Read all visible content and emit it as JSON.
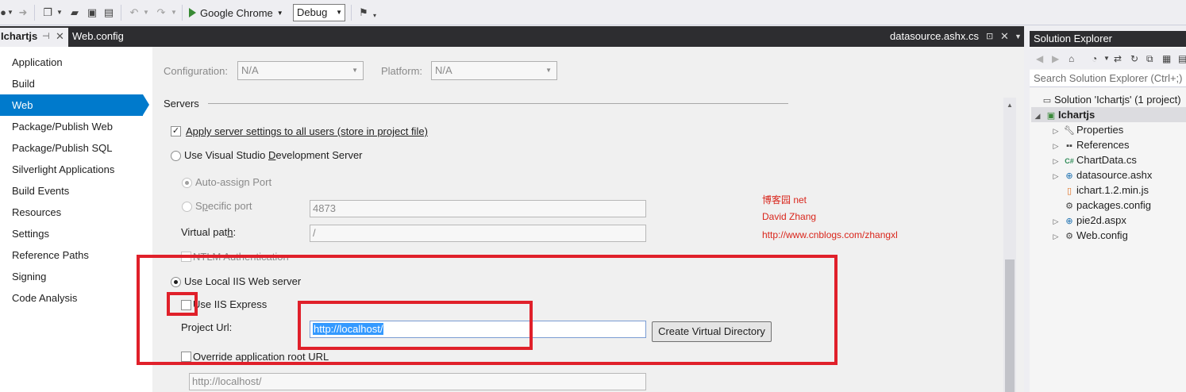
{
  "toolbar": {
    "run_target": "Google Chrome",
    "configuration": "Debug"
  },
  "tabs": {
    "active": "Ichartjs",
    "second": "Web.config",
    "right": "datasource.ashx.cs"
  },
  "nav": {
    "items": [
      "Application",
      "Build",
      "Web",
      "Package/Publish Web",
      "Package/Publish SQL",
      "Silverlight Applications",
      "Build Events",
      "Resources",
      "Settings",
      "Reference Paths",
      "Signing",
      "Code Analysis"
    ],
    "selected": "Web"
  },
  "config_bar": {
    "configuration_label": "Configuration:",
    "configuration_value": "N/A",
    "platform_label": "Platform:",
    "platform_value": "N/A"
  },
  "servers": {
    "section_title": "Servers",
    "apply_settings_label": "Apply server settings to all users (store in project file)",
    "apply_settings_checked": true,
    "vs_dev_server_label_pre": "Use Visual Studio ",
    "vs_dev_server_label_u": "D",
    "vs_dev_server_label_post": "evelopment Server",
    "auto_assign_port_label": "Auto-assign Port",
    "specific_port_label_pre": "S",
    "specific_port_label_u": "p",
    "specific_port_label_post": "ecific port",
    "specific_port_value": "4873",
    "virtual_path_label_pre": "Virtual pat",
    "virtual_path_label_u": "h",
    "virtual_path_label_post": ":",
    "virtual_path_value": "/",
    "ntlm_label": "NTLM Authentication",
    "local_iis_label": "Use Local IIS Web server",
    "local_iis_checked": true,
    "use_iis_express_label": "Use IIS Express",
    "use_iis_express_checked": false,
    "project_url_label": "Project Url:",
    "project_url_value": "http://localhost/",
    "create_vdir_label": "Create Virtual Directory",
    "override_root_label": "Override application root URL",
    "override_root_checked": false,
    "override_root_value": "http://localhost/"
  },
  "watermark": {
    "line1": "博客园 net",
    "line2": "David Zhang",
    "line3": "http://www.cnblogs.com/zhangxl"
  },
  "solution_explorer": {
    "title": "Solution Explorer",
    "search_placeholder": "Search Solution Explorer (Ctrl+;)",
    "solution_label": "Solution 'Ichartjs' (1 project)",
    "project_label": "Ichartjs",
    "items": [
      "Properties",
      "References",
      "ChartData.cs",
      "datasource.ashx",
      "ichart.1.2.min.js",
      "packages.config",
      "pie2d.aspx",
      "Web.config"
    ]
  },
  "colors": {
    "accent": "#007acc",
    "annotation_red": "#e0202a",
    "watermark_red": "#d9261c"
  }
}
